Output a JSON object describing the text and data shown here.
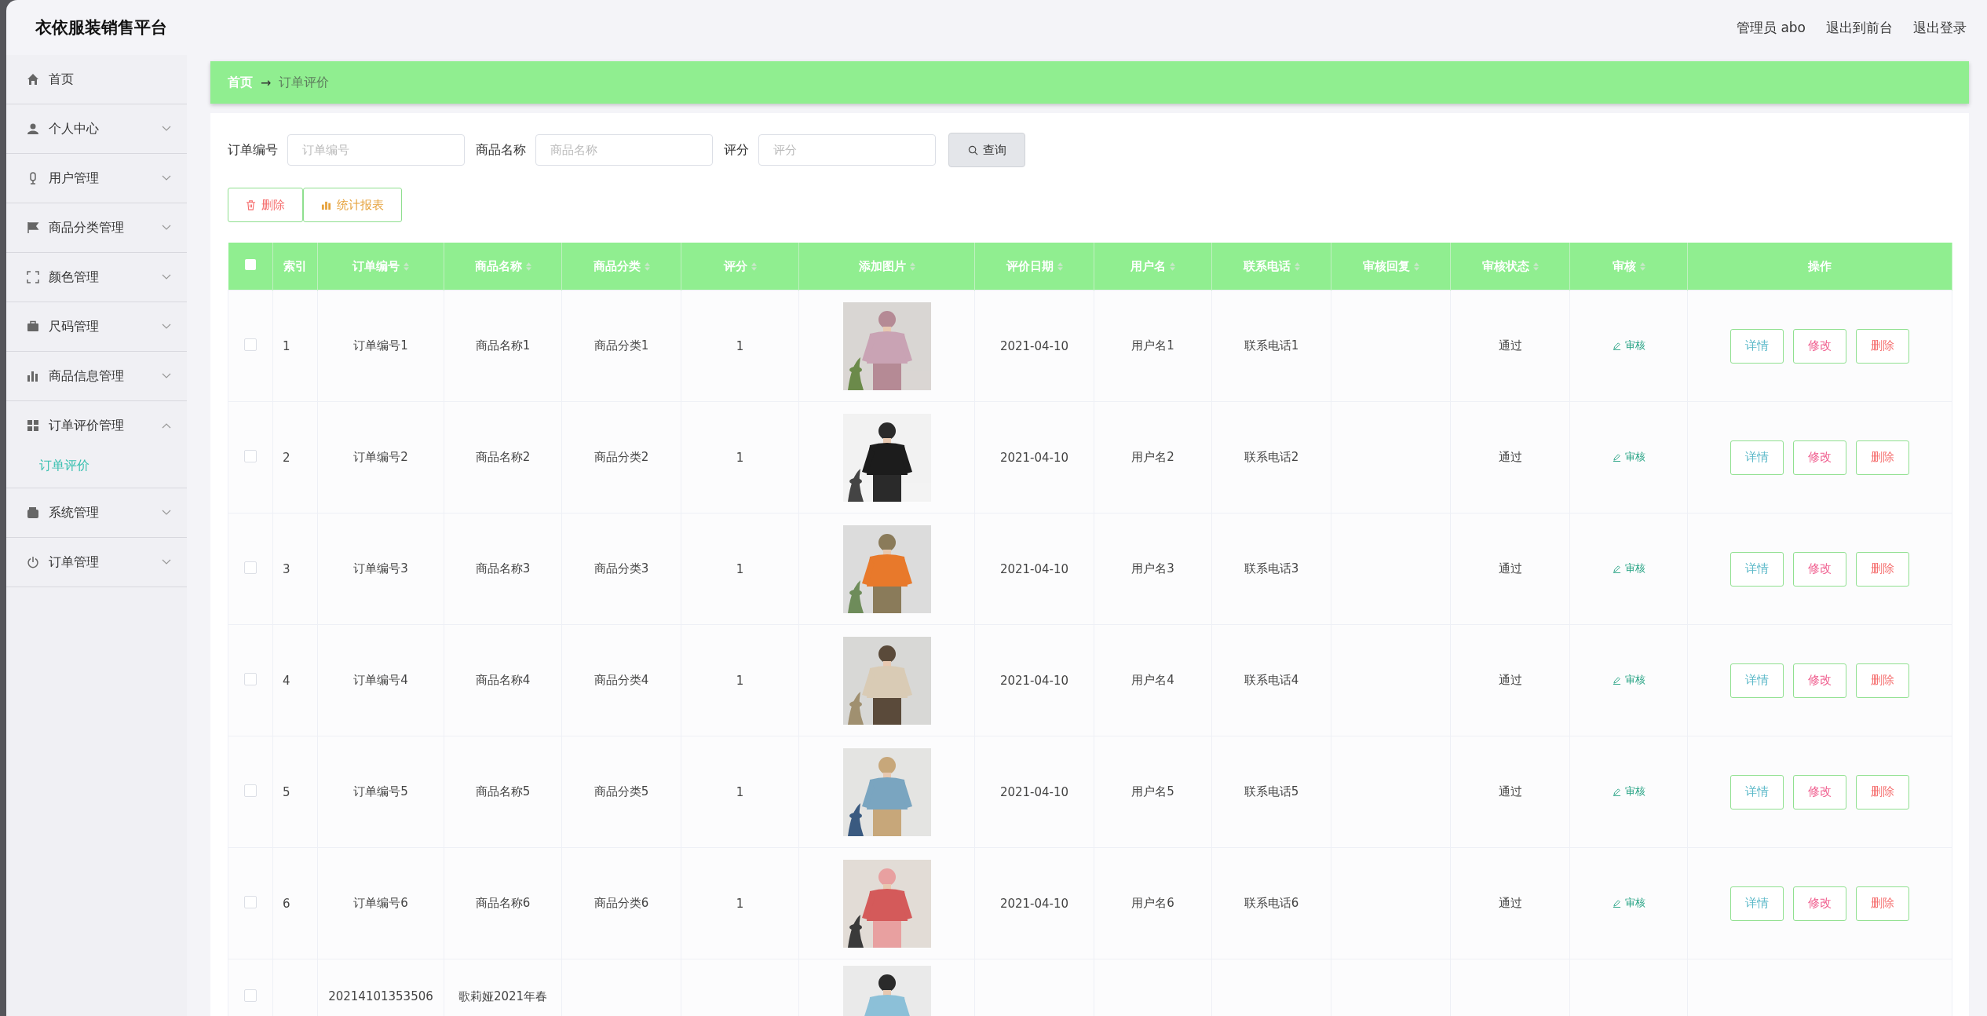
{
  "header": {
    "title": "衣依服装销售平台",
    "user": "管理员 abo",
    "links": [
      "退出到前台",
      "退出登录"
    ]
  },
  "sidebar": {
    "items": [
      {
        "label": "首页",
        "kind": "link"
      },
      {
        "label": "个人中心",
        "kind": "menu",
        "expanded": false
      },
      {
        "label": "用户管理",
        "kind": "menu",
        "expanded": false
      },
      {
        "label": "商品分类管理",
        "kind": "menu",
        "expanded": false
      },
      {
        "label": "颜色管理",
        "kind": "menu",
        "expanded": false
      },
      {
        "label": "尺码管理",
        "kind": "menu",
        "expanded": false
      },
      {
        "label": "商品信息管理",
        "kind": "menu",
        "expanded": false
      },
      {
        "label": "订单评价管理",
        "kind": "menu",
        "expanded": true,
        "children": [
          {
            "label": "订单评价",
            "selected": true
          }
        ]
      },
      {
        "label": "系统管理",
        "kind": "menu",
        "expanded": false
      },
      {
        "label": "订单管理",
        "kind": "menu",
        "expanded": false
      }
    ]
  },
  "breadcrumb": [
    "首页",
    "→",
    "订单评价"
  ],
  "filters": [
    {
      "label": "订单编号",
      "placeholder": "订单编号"
    },
    {
      "label": "商品名称",
      "placeholder": "商品名称"
    },
    {
      "label": "评分",
      "placeholder": "评分"
    }
  ],
  "search_button": "查询",
  "actions": [
    {
      "label": "删除",
      "kind": "delete"
    },
    {
      "label": "统计报表",
      "kind": "report"
    }
  ],
  "table": {
    "select_all_checked": false,
    "columns": [
      {
        "label": "索引",
        "sortable": false
      },
      {
        "label": "订单编号",
        "sortable": true
      },
      {
        "label": "商品名称",
        "sortable": true
      },
      {
        "label": "商品分类",
        "sortable": true
      },
      {
        "label": "评分",
        "sortable": true
      },
      {
        "label": "添加图片",
        "sortable": true
      },
      {
        "label": "评价日期",
        "sortable": true
      },
      {
        "label": "用户名",
        "sortable": true
      },
      {
        "label": "联系电话",
        "sortable": true
      },
      {
        "label": "审核回复",
        "sortable": true
      },
      {
        "label": "审核状态",
        "sortable": true
      },
      {
        "label": "审核",
        "sortable": true
      },
      {
        "label": "操作",
        "sortable": false
      }
    ],
    "rows": [
      {
        "checked": false,
        "index": "1",
        "order_no": "订单编号1",
        "product": "商品名称1",
        "category": "商品分类1",
        "rating": "1",
        "date": "2021-04-10",
        "username": "用户名1",
        "phone": "联系电话1",
        "status": "通过",
        "review": "审核",
        "buttons": [
          "详情",
          "修改",
          "删除"
        ]
      },
      {
        "checked": false,
        "index": "2",
        "order_no": "订单编号2",
        "product": "商品名称2",
        "category": "商品分类2",
        "rating": "1",
        "date": "2021-04-10",
        "username": "用户名2",
        "phone": "联系电话2",
        "status": "通过",
        "review": "审核",
        "buttons": [
          "详情",
          "修改",
          "删除"
        ]
      },
      {
        "checked": false,
        "index": "3",
        "order_no": "订单编号3",
        "product": "商品名称3",
        "category": "商品分类3",
        "rating": "1",
        "date": "2021-04-10",
        "username": "用户名3",
        "phone": "联系电话3",
        "status": "通过",
        "review": "审核",
        "buttons": [
          "详情",
          "修改",
          "删除"
        ]
      },
      {
        "checked": false,
        "index": "4",
        "order_no": "订单编号4",
        "product": "商品名称4",
        "category": "商品分类4",
        "rating": "1",
        "date": "2021-04-10",
        "username": "用户名4",
        "phone": "联系电话4",
        "status": "通过",
        "review": "审核",
        "buttons": [
          "详情",
          "修改",
          "删除"
        ]
      },
      {
        "checked": false,
        "index": "5",
        "order_no": "订单编号5",
        "product": "商品名称5",
        "category": "商品分类5",
        "rating": "1",
        "date": "2021-04-10",
        "username": "用户名5",
        "phone": "联系电话5",
        "status": "通过",
        "review": "审核",
        "buttons": [
          "详情",
          "修改",
          "删除"
        ]
      },
      {
        "checked": false,
        "index": "6",
        "order_no": "订单编号6",
        "product": "商品名称6",
        "category": "商品分类6",
        "rating": "1",
        "date": "2021-04-10",
        "username": "用户名6",
        "phone": "联系电话6",
        "status": "通过",
        "review": "审核",
        "buttons": [
          "详情",
          "修改",
          "删除"
        ]
      },
      {
        "checked": false,
        "order_no": "20214101353506",
        "product": "歌莉娅2021年春"
      }
    ]
  }
}
